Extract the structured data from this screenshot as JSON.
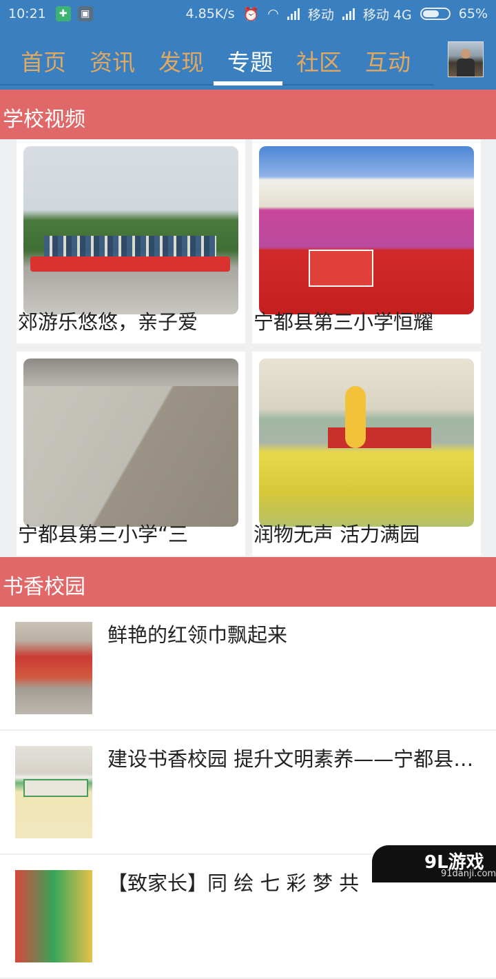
{
  "status_bar": {
    "time": "10:21",
    "net_speed": "4.85K/s",
    "carrier1": "移动",
    "carrier2": "移动 4G",
    "battery": "65%",
    "battery_level": 0.65
  },
  "nav": {
    "tabs": [
      {
        "label": "首页"
      },
      {
        "label": "资讯"
      },
      {
        "label": "发现"
      },
      {
        "label": "专题"
      },
      {
        "label": "社区"
      },
      {
        "label": "互动"
      }
    ],
    "active_index": 3,
    "colors": {
      "bar": "#3a7fbf",
      "inactive": "#e0a860",
      "active": "#ffffff"
    }
  },
  "section1": {
    "title": "学校视频",
    "cards": [
      {
        "caption": "郊游乐悠悠，亲子爱"
      },
      {
        "caption": "宁都县第三小学恒耀"
      },
      {
        "caption": "宁都县第三小学“三"
      },
      {
        "caption": "润物无声 活力满园"
      }
    ]
  },
  "section2": {
    "title": "书香校园",
    "items": [
      {
        "title": "鲜艳的红领巾飘起来"
      },
      {
        "title": "建设书香校园  提升文明素养——宁都县第三小学"
      },
      {
        "title": "【致家长】同 绘 七 彩 梦  共"
      }
    ]
  },
  "accent_color": "#e06868",
  "watermark": {
    "logo": "9L游戏",
    "site": "91danji.com"
  }
}
